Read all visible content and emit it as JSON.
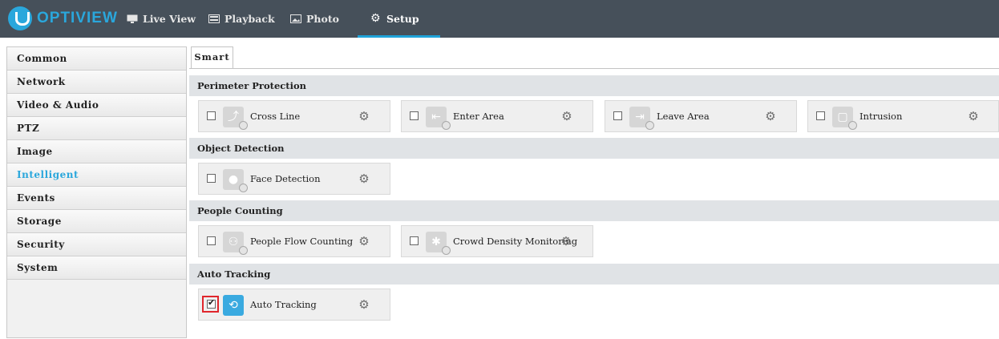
{
  "brand": {
    "name": "OPTIVIEW"
  },
  "topnav": [
    {
      "label": "Live View",
      "icon": "monitor-icon"
    },
    {
      "label": "Playback",
      "icon": "filmstrip-icon"
    },
    {
      "label": "Photo",
      "icon": "photo-icon"
    },
    {
      "label": "Setup",
      "icon": "gear-icon",
      "active": true
    }
  ],
  "sidebar": {
    "items": [
      {
        "label": "Common"
      },
      {
        "label": "Network"
      },
      {
        "label": "Video & Audio"
      },
      {
        "label": "PTZ"
      },
      {
        "label": "Image"
      },
      {
        "label": "Intelligent",
        "active": true
      },
      {
        "label": "Events"
      },
      {
        "label": "Storage"
      },
      {
        "label": "Security"
      },
      {
        "label": "System"
      }
    ]
  },
  "tab": {
    "label": "Smart"
  },
  "sections": {
    "perimeter": {
      "title": "Perimeter Protection",
      "items": [
        {
          "label": "Cross Line",
          "checked": false,
          "icon": "cross-line-icon"
        },
        {
          "label": "Enter Area",
          "checked": false,
          "icon": "enter-area-icon"
        },
        {
          "label": "Leave Area",
          "checked": false,
          "icon": "leave-area-icon"
        },
        {
          "label": "Intrusion",
          "checked": false,
          "icon": "intrusion-icon"
        }
      ]
    },
    "object": {
      "title": "Object Detection",
      "items": [
        {
          "label": "Face Detection",
          "checked": false,
          "icon": "face-detection-icon"
        }
      ]
    },
    "people": {
      "title": "People Counting",
      "items": [
        {
          "label": "People Flow Counting",
          "checked": false,
          "icon": "people-flow-icon"
        },
        {
          "label": "Crowd Density Monitoring",
          "checked": false,
          "icon": "crowd-density-icon"
        }
      ]
    },
    "tracking": {
      "title": "Auto Tracking",
      "items": [
        {
          "label": "Auto Tracking",
          "checked": true,
          "icon": "auto-tracking-icon"
        }
      ]
    }
  },
  "colors": {
    "accent": "#2aa7dc",
    "topbar": "#46505a",
    "highlight": "#e0262c"
  }
}
